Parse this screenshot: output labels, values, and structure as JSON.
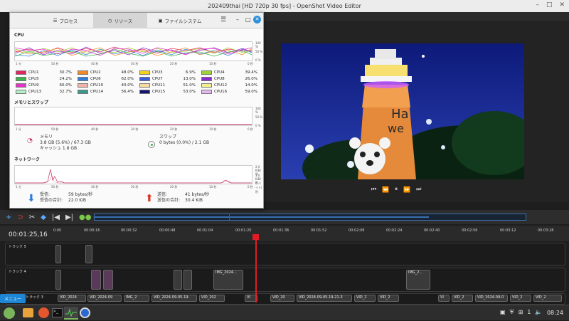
{
  "window": {
    "title": "202409thai [HD 720p 30 fps] - OpenShot Video Editor"
  },
  "sysmon": {
    "tabs": [
      {
        "label": "プロセス",
        "icon": "list-icon"
      },
      {
        "label": "リソース",
        "icon": "resource-icon"
      },
      {
        "label": "ファイルシステム",
        "icon": "disk-icon"
      }
    ],
    "cpu_title": "CPU",
    "mem_title": "メモリとスワップ",
    "net_title": "ネットワーク",
    "y_labels_pct": [
      "100 %",
      "50 %",
      "0 %"
    ],
    "y_labels_net": [
      "2.0 KiB/秒",
      "1.0 KiB/秒",
      "0 バイト/秒"
    ],
    "x_labels": [
      "1 分",
      "50 秒",
      "40 秒",
      "30 秒",
      "20 秒",
      "10 秒",
      "0 秒"
    ],
    "cpus": [
      {
        "name": "CPU1",
        "value": "30.7%",
        "color": "#e3265f"
      },
      {
        "name": "CPU2",
        "value": "48.0%",
        "color": "#f28a24"
      },
      {
        "name": "CPU3",
        "value": "6.9%",
        "color": "#f5d21c"
      },
      {
        "name": "CPU4",
        "value": "39.4%",
        "color": "#a0d232"
      },
      {
        "name": "CPU5",
        "value": "24.2%",
        "color": "#3cb44b"
      },
      {
        "name": "CPU6",
        "value": "62.0%",
        "color": "#2f7fd9"
      },
      {
        "name": "CPU7",
        "value": "13.0%",
        "color": "#3c5fd9"
      },
      {
        "name": "CPU8",
        "value": "26.0%",
        "color": "#8a2ad1"
      },
      {
        "name": "CPU9",
        "value": "60.0%",
        "color": "#e632c8"
      },
      {
        "name": "CPU10",
        "value": "40.0%",
        "color": "#f5b4a8"
      },
      {
        "name": "CPU11",
        "value": "51.0%",
        "color": "#f7dca0"
      },
      {
        "name": "CPU12",
        "value": "14.0%",
        "color": "#f2f28c"
      },
      {
        "name": "CPU13",
        "value": "32.7%",
        "color": "#b4f0c8"
      },
      {
        "name": "CPU14",
        "value": "56.4%",
        "color": "#3a9a8c"
      },
      {
        "name": "CPU15",
        "value": "53.0%",
        "color": "#14146e"
      },
      {
        "name": "CPU16",
        "value": "59.0%",
        "color": "#e8b8f0"
      }
    ],
    "memory": {
      "label": "メモリ",
      "line1": "3.8 GB (5.6%) / 67.3 GB",
      "line2": "キャッシュ 1.8 GB"
    },
    "swap": {
      "label": "スワップ",
      "line1": "0 bytes (0.0%) / 2.1 GB"
    },
    "net": {
      "recv_label": "受信:",
      "recv_value": "59 bytes/秒",
      "recv_total_label": "受信の合計:",
      "recv_total_value": "22.0 KiB",
      "send_label": "送信:",
      "send_value": "41 bytes/秒",
      "send_total_label": "送信の合計:",
      "send_total_value": "30.4 KiB"
    }
  },
  "timeline": {
    "timecode": "00:01:25,16",
    "ticks": [
      "0:00",
      "00:00:16",
      "00:00:32",
      "00:00:48",
      "00:01:04",
      "00:01:20",
      "00:01:36",
      "00:01:52",
      "00:02:08",
      "00:02:24",
      "00:02:40",
      "00:02:56",
      "00:03:12",
      "00:03:28"
    ],
    "tracks": [
      {
        "name": "トラック 5"
      },
      {
        "name": "トラック 4"
      },
      {
        "name": "トラック 3"
      }
    ],
    "clips_track4": [
      "IMG_2024...",
      "IMG_2..."
    ],
    "clips_track3": [
      "VID_2024",
      "VID_2024-09",
      "IMG_2",
      "VID_2024-09-05-19-",
      "VID_202",
      "VI",
      "VID_20",
      "VID_2024-09-05-19-21-3",
      "VID_2",
      "VID_2",
      "VI",
      "VID_2",
      "VID_2024-09-0",
      "VID_2",
      "VID_2"
    ]
  },
  "taskbar": {
    "menu_tip": "メニュー",
    "clock": "08:24",
    "tray_count": "1"
  }
}
